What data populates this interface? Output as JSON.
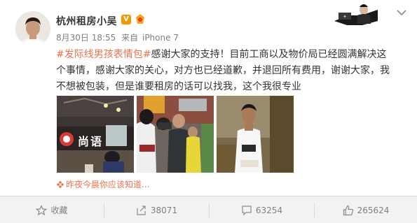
{
  "user": {
    "name": "杭州租房小吴",
    "verified_mark": "V"
  },
  "meta": {
    "date": "8月30日 18:55",
    "source_prefix": "来自",
    "source": "iPhone 7"
  },
  "post": {
    "hashtag": "#发际线男孩表情包#",
    "body": "感谢大家的支持！目前工商以及物价局已经圆满解决这个事情，感谢大家的关心，对方也已经道歉，并退回所有费用，谢谢大家，我不想被包装，但是谁要租房的话可以找我，这个我很专业"
  },
  "photos": [
    {
      "sign_text": "尚",
      "sign_text_2": "语"
    },
    {},
    {}
  ],
  "reason": {
    "text": "昨夜今晨你应该知道..."
  },
  "actions": {
    "favorite_label": "收藏",
    "repost_count": "38071",
    "comment_count": "63254",
    "like_count": "265624"
  },
  "colors": {
    "accent": "#eb7350",
    "verified": "#f39800",
    "action_bg": "#f2f2f5"
  },
  "icons": [
    "star-icon",
    "repost-icon",
    "comment-icon",
    "thumbs-up-icon",
    "chevron-down-icon",
    "flower-icon",
    "verified-icon",
    "member-icon"
  ]
}
